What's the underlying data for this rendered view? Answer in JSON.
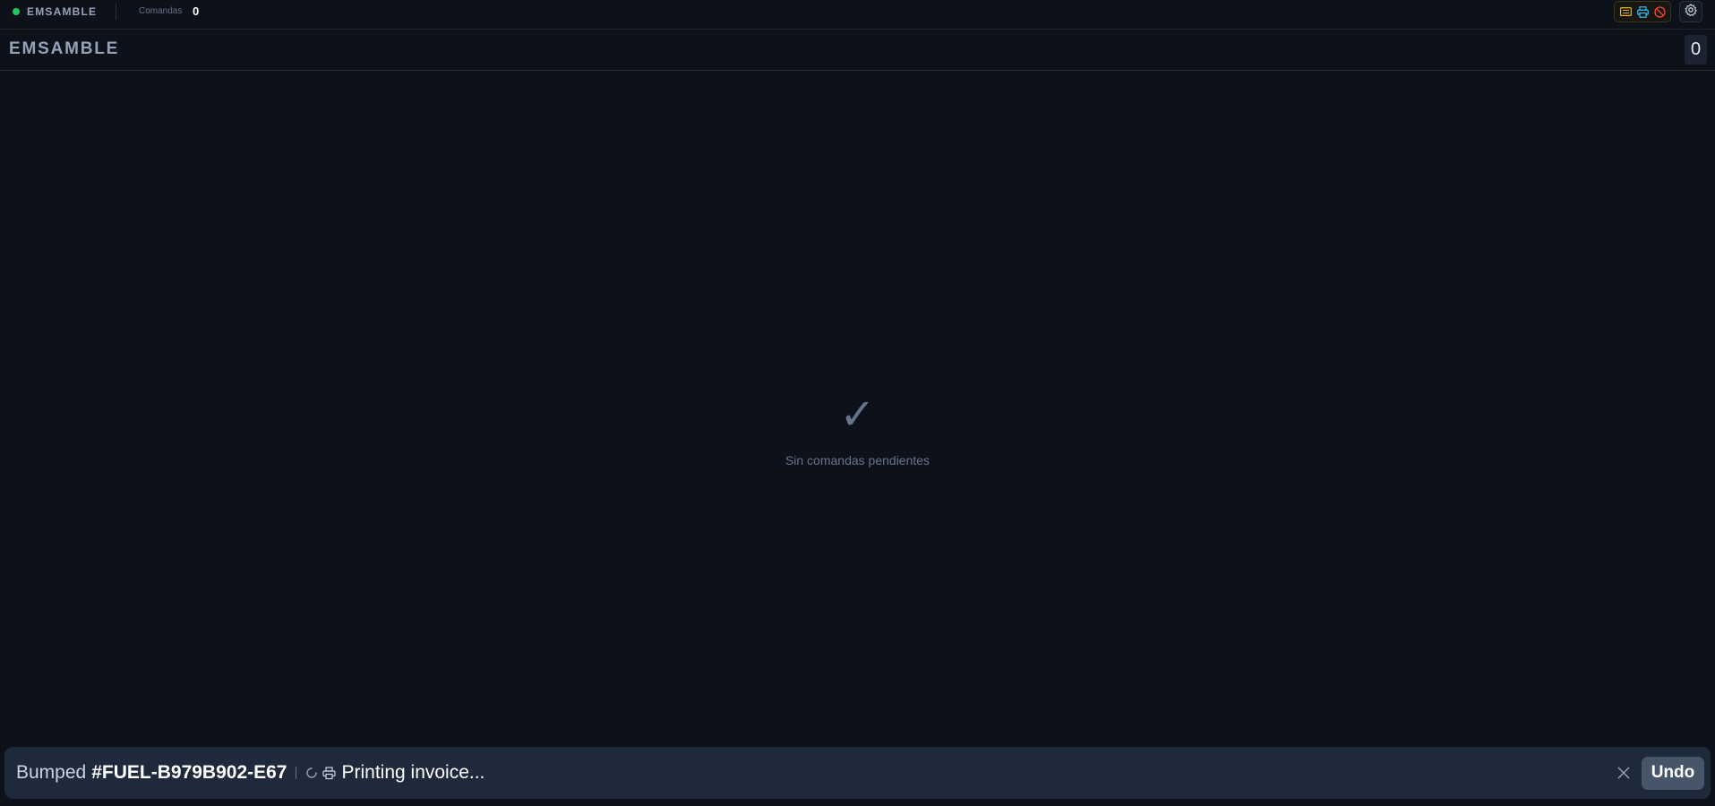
{
  "topbar": {
    "station_name": "EMSAMBLE",
    "orders_label": "Comandas",
    "orders_count": "0",
    "status_dot_color": "#22c55e",
    "device_icons": [
      "keyboard-icon",
      "printer-icon",
      "blocked-icon"
    ]
  },
  "header": {
    "title": "EMSAMBLE",
    "count": "0"
  },
  "empty_state": {
    "icon": "✓",
    "message": "Sin comandas pendientes"
  },
  "toast": {
    "prefix": "Bumped",
    "order_id": "#FUEL-B979B902-E67",
    "status": "Printing invoice...",
    "undo_label": "Undo"
  }
}
